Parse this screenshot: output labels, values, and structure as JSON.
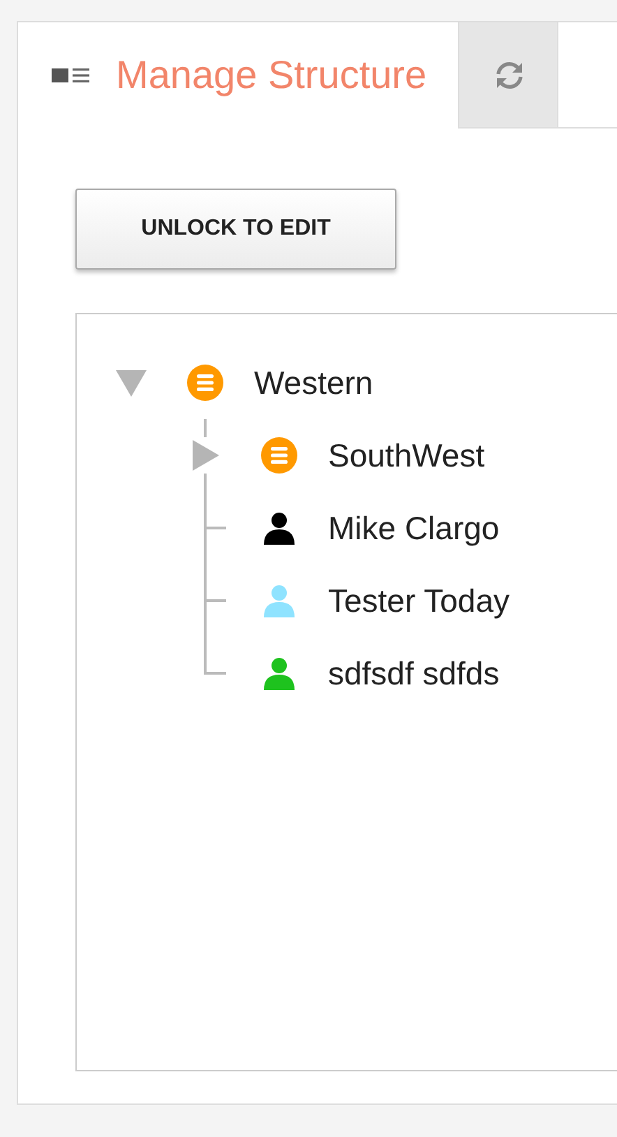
{
  "tabs": [
    {
      "kind": "text",
      "label": "Manage Structure",
      "selected": true
    },
    {
      "kind": "refresh",
      "selected": false
    }
  ],
  "unlock_button": "UNLOCK TO EDIT",
  "tree": [
    {
      "kind": "group",
      "label": "Western",
      "color": "#ff9900",
      "expanded": true,
      "children": [
        {
          "kind": "group",
          "label": "SouthWest",
          "color": "#ff9900",
          "expanded": false
        },
        {
          "kind": "person",
          "label": "Mike Clargo",
          "color": "#000000"
        },
        {
          "kind": "person",
          "label": "Tester Today",
          "color": "#8fe3ff"
        },
        {
          "kind": "person",
          "label": "sdfsdf sdfds",
          "color": "#1ec21e"
        }
      ]
    }
  ]
}
